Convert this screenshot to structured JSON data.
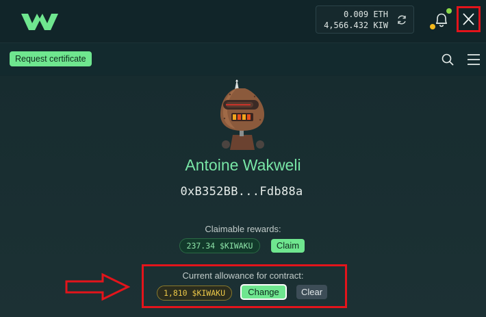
{
  "header": {
    "logo_icon": "kiwaku-w-logo",
    "wallet": {
      "eth_balance": "0.009 ETH",
      "kiw_balance": "4,566.432 KIW"
    },
    "refresh_icon": "refresh-icon",
    "bell_icon": "bell-icon",
    "close_icon": "close-icon"
  },
  "subbar": {
    "request_certificate_label": "Request certificate",
    "search_icon": "search-icon",
    "menu_icon": "hamburger-menu-icon"
  },
  "profile": {
    "name": "Antoine Wakweli",
    "address": "0xB352BB...Fdb88a"
  },
  "rewards": {
    "label": "Claimable rewards:",
    "amount": "237.34 $KIWAKU",
    "claim_label": "Claim"
  },
  "allowance": {
    "label": "Current allowance for contract:",
    "amount": "1,810 $KIWAKU",
    "change_label": "Change",
    "clear_label": "Clear"
  },
  "colors": {
    "accent": "#6fe68f",
    "name_green": "#78e6a6",
    "highlight_red": "#e3141b",
    "allowance_yellow": "#ecc748"
  }
}
